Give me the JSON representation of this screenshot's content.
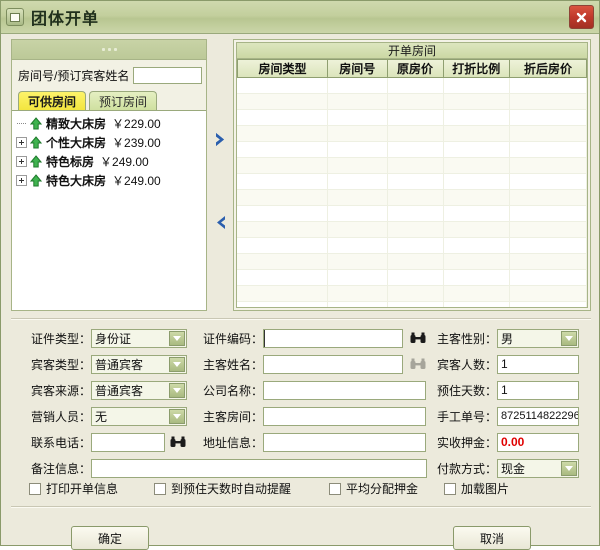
{
  "window": {
    "title": "团体开单",
    "system_icon": "minimize-square-icon",
    "close_icon": "close-icon",
    "close_color": "#c0392b",
    "titlebar_color": "#c3cf9d"
  },
  "left_panel": {
    "grip_icon": "drag-dots-icon",
    "search": {
      "label": "房间号/预订宾客姓名",
      "value": "",
      "placeholder": ""
    },
    "tabs": [
      {
        "label": "可供房间",
        "active": true
      },
      {
        "label": "预订房间",
        "active": false
      }
    ],
    "rooms": [
      {
        "expander": "none",
        "icon": "green-up-arrow-icon",
        "name": "精致大床房",
        "price": "￥229.00"
      },
      {
        "expander": "plus",
        "icon": "green-up-arrow-icon",
        "name": "个性大床房",
        "price": "￥239.00"
      },
      {
        "expander": "plus",
        "icon": "green-up-arrow-icon",
        "name": "特色标房",
        "price": "￥249.00"
      },
      {
        "expander": "plus",
        "icon": "green-up-arrow-icon",
        "name": "特色大床房",
        "price": "￥249.00"
      }
    ]
  },
  "transfer": {
    "add_icon": "chevron-right-icon",
    "remove_icon": "chevron-left-icon",
    "arrow_color": "#2b5fae"
  },
  "right_panel": {
    "title": "开单房间",
    "columns": [
      "房间类型",
      "房间号",
      "原房价",
      "打折比例",
      "折后房价"
    ],
    "rows": []
  },
  "form": {
    "cert_type": {
      "label": "证件类型：",
      "value": "身份证"
    },
    "guest_type": {
      "label": "宾客类型：",
      "value": "普通宾客"
    },
    "guest_source": {
      "label": "宾客来源：",
      "value": "普通宾客"
    },
    "sales_person": {
      "label": "营销人员：",
      "value": "无"
    },
    "phone": {
      "label": "联系电话：",
      "value": "",
      "search_icon": "binoculars-icon"
    },
    "remark": {
      "label": "备注信息：",
      "value": ""
    },
    "cert_no": {
      "label": "证件编码：",
      "value": "",
      "search_icon": "binoculars-icon",
      "focused": true
    },
    "main_guest_name": {
      "label": "主客姓名：",
      "value": "",
      "search_icon": "binoculars-icon",
      "search_disabled": true
    },
    "company": {
      "label": "公司名称：",
      "value": ""
    },
    "main_room": {
      "label": "主客房间：",
      "value": ""
    },
    "address": {
      "label": "地址信息：",
      "value": ""
    },
    "gender": {
      "label": "主客性别：",
      "value": "男"
    },
    "guest_count": {
      "label": "宾客人数：",
      "value": "1"
    },
    "stay_days": {
      "label": "预住天数：",
      "value": "1"
    },
    "manual_no": {
      "label": "手工单号：",
      "value": "8725114822296"
    },
    "deposit": {
      "label": "实收押金：",
      "value": "0.00",
      "color": "#e00000"
    },
    "payment": {
      "label": "付款方式：",
      "value": "现金"
    }
  },
  "checkboxes": [
    {
      "label": "打印开单信息",
      "checked": false
    },
    {
      "label": "到预住天数时自动提醒",
      "checked": false
    },
    {
      "label": "平均分配押金",
      "checked": false
    },
    {
      "label": "加载图片",
      "checked": false
    }
  ],
  "footer": {
    "ok": "确定",
    "cancel": "取消"
  }
}
